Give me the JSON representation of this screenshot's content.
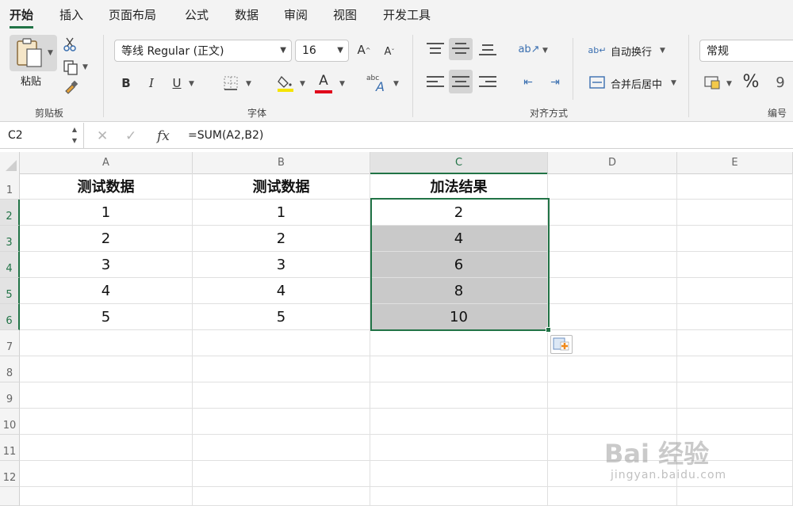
{
  "ribbon_tabs": [
    "开始",
    "插入",
    "页面布局",
    "公式",
    "数据",
    "审阅",
    "视图",
    "开发工具"
  ],
  "active_tab": "开始",
  "clipboard": {
    "paste_label": "粘贴",
    "group_label": "剪贴板"
  },
  "font": {
    "name": "等线 Regular (正文)",
    "size": "16",
    "group_label": "字体",
    "bold": "B",
    "italic": "I",
    "underline": "U",
    "font_color_letter": "A",
    "grow": "A",
    "shrink": "A",
    "phonetic": "abc",
    "highlight_color": "#f5e400",
    "font_color": "#e0001a"
  },
  "alignment": {
    "wrap_text": "自动换行",
    "merge_center": "合并后居中",
    "group_label": "对齐方式"
  },
  "number": {
    "format": "常规",
    "percent": "%",
    "group_label": "编号"
  },
  "formula_bar": {
    "name_box": "C2",
    "fx": "fx",
    "formula": "=SUM(A2,B2)"
  },
  "columns": [
    "A",
    "B",
    "C",
    "D",
    "E"
  ],
  "rows": [
    "1",
    "2",
    "3",
    "4",
    "5",
    "6",
    "7",
    "8",
    "9",
    "10",
    "11",
    "12"
  ],
  "cells": [
    [
      "测试数据",
      "测试数据",
      "加法结果"
    ],
    [
      "1",
      "1",
      "2"
    ],
    [
      "2",
      "2",
      "4"
    ],
    [
      "3",
      "3",
      "6"
    ],
    [
      "4",
      "4",
      "8"
    ],
    [
      "5",
      "5",
      "10"
    ]
  ],
  "watermark": {
    "text": "Bai 经验",
    "sub": "jingyan.baidu.com"
  },
  "accent_color": "#217346"
}
